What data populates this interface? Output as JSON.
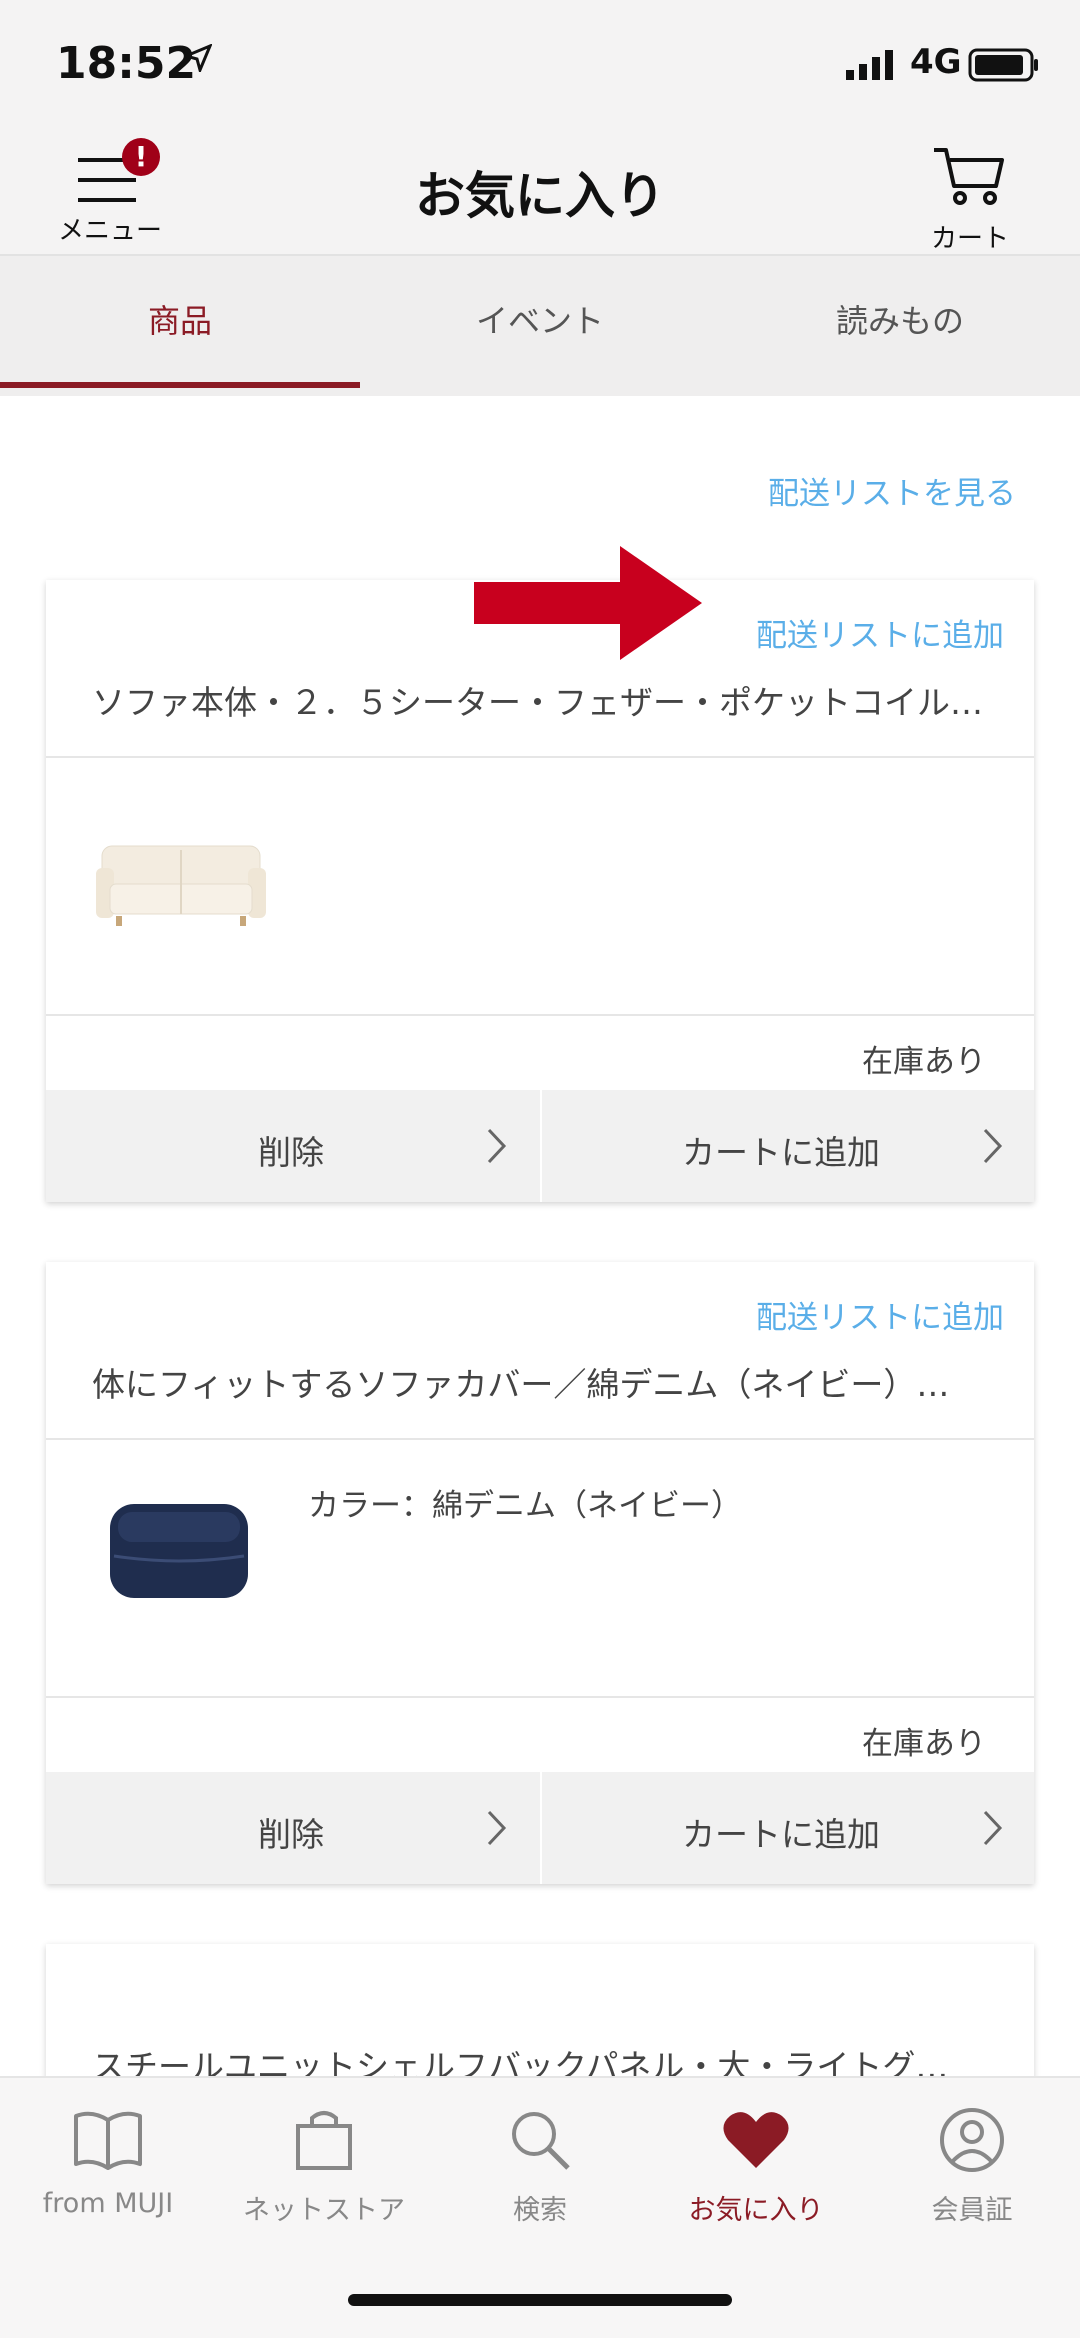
{
  "status": {
    "time": "18:52",
    "network": "4G"
  },
  "header": {
    "menu_label": "メニュー",
    "menu_badge": "!",
    "title": "お気に入り",
    "cart_label": "カート"
  },
  "tabs": [
    {
      "label": "商品",
      "active": true
    },
    {
      "label": "イベント",
      "active": false
    },
    {
      "label": "読みもの",
      "active": false
    }
  ],
  "view_list_link": "配送リストを見る",
  "items": [
    {
      "add_to_list": "配送リストに追加",
      "title": "ソファ本体・２．５シーター・フェザー・ポケットコイル…",
      "color": "",
      "stock": "在庫あり",
      "delete_label": "削除",
      "add_cart_label": "カートに追加"
    },
    {
      "add_to_list": "配送リストに追加",
      "title": "体にフィットするソファカバー／綿デニム（ネイビー）…",
      "color": "カラー：綿デニム（ネイビー）",
      "stock": "在庫あり",
      "delete_label": "削除",
      "add_cart_label": "カートに追加"
    },
    {
      "title": "スチールユニットシェルフバックパネル・大・ライトグ…"
    }
  ],
  "bottom_nav": [
    {
      "label": "from MUJI",
      "icon": "book-icon"
    },
    {
      "label": "ネットストア",
      "icon": "shopping-bag-icon"
    },
    {
      "label": "検索",
      "icon": "search-icon"
    },
    {
      "label": "お気に入り",
      "icon": "heart-icon",
      "active": true
    },
    {
      "label": "会員証",
      "icon": "member-icon"
    }
  ],
  "colors": {
    "accent": "#8b1b25",
    "link": "#5aaee8",
    "annotation_arrow": "#c8001e"
  }
}
